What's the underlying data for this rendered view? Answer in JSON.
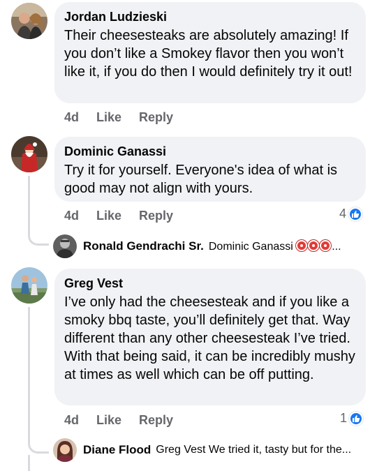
{
  "comments": [
    {
      "author": "Jordan Ludzieski",
      "text": "Their cheesesteaks are absolutely amazing! If you don’t like a Smokey flavor then you won’t like it, if you do then I would definitely try it out!",
      "time": "4d",
      "like_label": "Like",
      "reply_label": "Reply"
    },
    {
      "author": "Dominic Ganassi",
      "text": "Try it for yourself. Everyone's idea of what is good may not align with yours.",
      "time": "4d",
      "like_label": "Like",
      "reply_label": "Reply",
      "reaction_count": "4",
      "reply": {
        "author": "Ronald Gendrachi Sr.",
        "snippet": "Dominic Ganassi",
        "ellipsis": "..."
      }
    },
    {
      "author": "Greg Vest",
      "text": "I’ve only had the cheesesteak and if you like a smoky bbq taste, you’ll definitely get that. Way different than any other cheesesteak I’ve tried. With that being said, it can be incredibly mushy at times as well which can be off putting.",
      "time": "4d",
      "like_label": "Like",
      "reply_label": "Reply",
      "reaction_count": "1",
      "reply": {
        "author": "Diane Flood",
        "snippet": "Greg Vest We tried it, tasty but for the..."
      }
    }
  ],
  "icons": {
    "like_reaction": "thumbs-up-icon",
    "target_emoji": "direct-hit-emoji"
  },
  "colors": {
    "bubble": "#f0f2f5",
    "meta_text": "#65676b",
    "like_blue": "#1877f2",
    "thread_line": "#d8dadf"
  }
}
